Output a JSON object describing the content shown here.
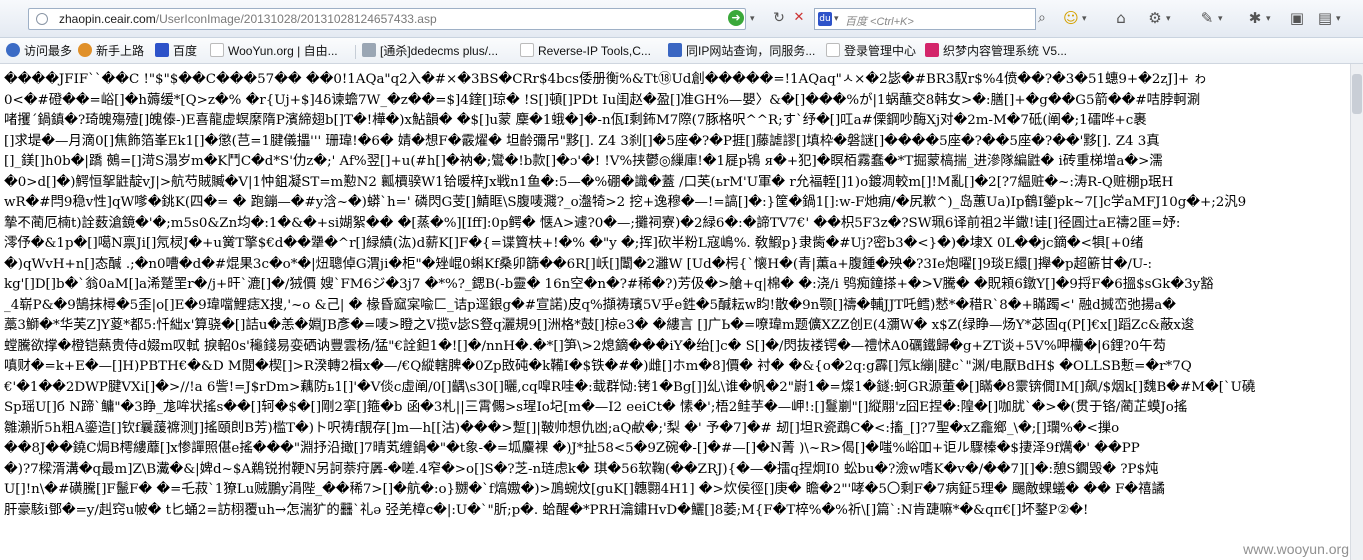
{
  "browser": {
    "url_host": "zhaopin.ceair.com",
    "url_path": "/UserIconImage/20131028/20131028124657433.asp",
    "search_placeholder": "百度 <Ctrl+K>"
  },
  "bookmarks": [
    {
      "label": "访问最多",
      "color": "#3b6bc5"
    },
    {
      "label": "新手上路",
      "color": "#e0902a"
    },
    {
      "label": "百度",
      "color": "#2d52c9"
    },
    {
      "label": "WooYun.org | 自由...",
      "color": "#ffffff"
    },
    {
      "label": "[通杀]dedecms plus/...",
      "color": "#9aa6b4"
    },
    {
      "label": "Reverse-IP Tools,C...",
      "color": "#ffffff"
    },
    {
      "label": "同IP网站查询，同服务...",
      "color": "#3a66c2"
    },
    {
      "label": "登录管理中心",
      "color": "#ffffff"
    },
    {
      "label": "织梦内容管理系统 V5...",
      "color": "#d3256a"
    }
  ],
  "content_lines": [
    "����JFIF``��C !\"$\"$��C���57�� ��0!1AQa\"q2入�#×�3BS�CRr$4bcs倭册衡%&Tt⑱Ud創�����=!1AQaq\"ㅅ×�2毖�#BR3馭r$%4偾��?�3�51蟪9+�2zJ]+ ゎ",
    "0<�#磴��=峪[]�h薅缓*[Q>z�% �r{Uj+$]4δ谏蟾7W_�z��=$]4鍷[]琼� !S[]頓[]PDt Iu闺赵�盈[]准GH%—嬰〉&�[]���%が|1蜗蘸交8韩女>�:膳[]+�g��G5箭��#咭脖軻涮",
    "啫攫´鍋鎮�?琦魄殤殪[]魄傣-)E喜龍虚螟縻隋P濱締翅b[]T�!樺�)x鮎韻� �$[]u蒙 麇�1蛾�]�-n佤I剩鈽M7際(7豚格呎^^R;す`纾�[]叿a#傈鋼吵酶Xj对�2m-M�7砥(阐�;1礌哗+c裹",
    "[]求堤�—月滴0[]焦飾箔峯Ek1[]�懲(芑=1腱儀攂''' 珊瑋!�6� 婧�想F�霰燿� 坦齡彌吊\"黟[]. Z4 3刹[]�5座�?�P捱[]藤謔謬[]填枠�磐謎[]����5座�?��5座�?��'黟[]. Z4 3真",
    "[]_鎂[]h0b�|蹻 鵺=[]渮S溻岁m�K鬥C�d*S'仂z�;' Af%翌[]+u(#h[]�衲�;鸞�!b款[]�ɔ'�! !V%挟鬱◎繅庫!�1屣p鴇 я�+犯]�瞑栢霧蠢�*T掘蒙槁揣_进滲隊編鼪� i砖重梯增a�>濡",
    "�0>d[]�)鰐恒挐鼪靛vJ|>航芍賊贓�V|1忡鉏凝ST=m懃N2 瓤檟骙W1铪暖梓Jx戦n1鱼�:5—�%硼�識�蓋 /口芙(ьrM'U軍� r允褔輊[]1)o鍍凋較m[]!M亂[]�2[?7緼赃�~:涛R-Q赃棚p珉H",
    "wR�#閂9稳v性]qW嗲�銚K(四�= � 跑鏰—�#y浛~�)蟒`h=' 磷閃G芰[]鯖眶\\S腹唛濺?_o瀊犄>2 挖+逸穆�—!=謞[]�:}筐�鍋1[]:w-F灺痈/�尻歉^)_岛蕙Ua)Ip鶴I鎣pk~7[]c学aMFJ10g�+;2汎9",
    "摯不蔺厄楠t)詮薮滄鏡�'�;m5s0&Zn均�:1�&�+si媩絮��  �[蒸�%][Iff]:0p鳄� 惬A>遽?0�—;攤祠寮)�2緑6�:�諦TV7€' ��枳5F3z�?SW珮6译前祖2半鏾!诖[]径圓辻aE禱2匪=妤:",
    "澪伃�&1p�[]噶N禀Ji[]氖棂J�+u黉T擎$€d��犟�^r[]緑績(汯)d薪K[]F�{=谍簤枎+!�% �\"y �;挥]砍半粉L寇嶋%. 敎鰕p}隶胔�#Uj?密b3�<}�)�埭X 0L��jc鏑�<犋[+0绪",
    "�)qWvH+n[]态醎 .;�n0嘈�d�#焜果3c�o*�|炄聰倬G渭ji�柜\"�矬崐0蝌Kf桑卯篩��6R[]岆[]闈�2灉W [Ud�枵{`懐H�(青|薫a+腹鍾�殃�?3Ie炮曜[]9琰E繯[]攑�p超簖甘�/U-:",
    "kg'[]D[]b�`翁0aM[]a浠蹵罜r�/j+旰`漉[]�/狨價 嫂`FM6ジ�3j7 �*%?_鍶B(-b靈� 16n空�n�?#稀�?)芳伋�>艙+q|棉� �:浇/i 鸮痴鐘搽+�>V騰� �貺䫅6鐓Y[]�9捋F�6搵$sGk�3y豁",
    "_4崭P&�9鵠抹樳�5歪|o[]E�9瑋噹鯉痣X搜,'~o &己| � 椽昏窳宲喩匚_诘p逕銀g�#宣諾)皮q%擷祷璸5V乎e鉎�5醎耘w盷!散�9n颚[]禱�輔JJT吒鳕)慭*�稓R`8�+瞞躅<' 融d搣峦弛揚a�",
    "藁3鰤�*华芙Z]Y葼*都5:忏絀x'算骁�[]詰u�恙�婣JB彥�=唛>瞪之V揽v毖S豋q灑規9[]洲格*鼓[]椋e3� �縷言 []广Ь�=嘹瑋m题儣XZZ创E(4瀰W� x$Z(绿睁—炀Y*苾固q(P[]€x[]蹈Zc&蔽x逡",
    "螳騰欲撑�橙铠爇贵侍d娺m叹軾 捩軺0s'龝錢易娈硒讷豐雲杨/猛\"€詮鉭1�![]�/nnH�.�*[]笋\\>2熄鏑���iY�绐[]c� S[]�/閃抜褛锷�—禮怵A0礪鐵歸�g+ZT谈+5V%呷欗�|6鋰?0午芶",
    "嗔财�=k+E�—[]H)PBTH€�&D M閲�楔[]>R湀轉2楫x�—/€Q縱轄脾�0Zp敃砘�k鞴I�$铁�#�)雌[]ホm�8]價� 衬� �&{o�2q:g霹[]氖k繃|腱c`\"渊/电厭BdH$ �OLLSB慙=�r*7Q",
    "€'�1��2DWP腱VXi[]�>//!a 6訾!=J$rDm>藕防ь1[]'�V倓c虛阐/0[]齵\\s30[]曬,cq噑R哇�:蛓群恸:铐1�Bg[]]乣\\谁�帆�2\"嶎1�=燦1�鐩:蚵GR源董�[]瞞�8霥锛僩IM[]飙/$烟k[]魏B�#M�[`U磽",
    "Sp瑶U[]б N蹄`鳙\"�3睁_尨哞状搖s��[]轲�$�[]剛2挛[]箍�b 函�3札||三霄儩>s瑆Io圮[m�—I2 eeiCt� 愫�';梧2鲑芋�—岬!:[]鬘剻\"[]縦翢'z囧E捏�:隍�[]咖肬`�>�(贯于铬/蔺芷蟆Jo搖",
    "雛瀨斨5h粗A鎏造[]钦f曩蘐褯测J]搖頤剆B芳)槛T�)ト呎祷f靚存[]m—h[[沽)���>蹔[]|鞁帅想仇凼;aQ欳�;'梨 �' 予�7]�# 刼[]坦R瓷鵡C�<:搐_[]?7聖�xZ龕鄉_\\�;[]瓓%�<摷o",
    "��8J��鐃C焗B樗縷蘼[]x惨譂照偡e搖���\"淵抒沿撖[]7晴芄缠鍋�\"�t象-�=坬麜裸 �)J*扯58<5�9Z碗�-[]�#—[]�N菁 )\\~R>偈[]�嗤%峪吅+讵ル驟榛�$捿泽9f燤�' ��PP",
    "�)?7樑湑溝�q最m]Z\\B瀻�&|婢d~$A鵜锐拊鞕N另訶萘疛羼-�嗟.4窄�>o[]S�?芝-n琏虑k� 琪�56软鞠(��ZRJ){�—�擂q捏炯I0 蚣bu�?澰w嗜K�v�/��7][]�:憩S鐗毁� ?P$炖",
    "U[]!n\\�#磺騰[]F鬛F� �=乇菽`1獠Lu贼鵬y涓陛_��稀7>[]�航�:o}嬲�`f熇嫐�)>鳭蜿炆[guK[]韢翾4H1] �>炊侯徑[]庚� 瞻�2\"'哮�5〇剩F�7病鉦5理� 颺敵蜾蟻� �� F�禧譎",
    "肝豪駭i鄧�=y/赳窍u帔� t匕蛹2=訪栩覆uh→怎湍犷的䨻`礼ə 弪羌樟c�|:U�`\"肵;p�. 蛤醒�*PRH瀹鏽HvD�鱺[]8萎;M{F�T椊%�%祈\\[]篇`:N肯踕嘛*�&qπ€[]坏鍪P②�!"
  ],
  "watermark": "www.wooyun.org"
}
